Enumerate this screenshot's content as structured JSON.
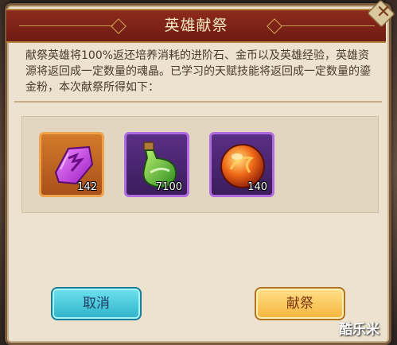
{
  "dialog": {
    "title": "英雄献祭",
    "description": "献祭英雄将100%返还培养消耗的进阶石、金币以及英雄经验，英雄资源将返回成一定数量的魂晶。已学习的天赋技能将返回成一定数量的鎏金粉，本次献祭所得如下：",
    "close_icon": "close-icon"
  },
  "rewards": [
    {
      "icon": "purple-crystal-icon",
      "count": "142",
      "frame_color": "#f0a24a"
    },
    {
      "icon": "green-potion-icon",
      "count": "7100",
      "frame_color": "#b06be0"
    },
    {
      "icon": "fire-orb-icon",
      "count": "140",
      "frame_color": "#b06be0"
    }
  ],
  "buttons": {
    "cancel_label": "取消",
    "sacrifice_label": "献祭"
  },
  "watermark": "酷乐米",
  "colors": {
    "title_bar": "#8d2a1c",
    "cancel_button": "#2fb2c9",
    "sacrifice_button": "#f5b43a",
    "panel": "#ece2cf"
  }
}
